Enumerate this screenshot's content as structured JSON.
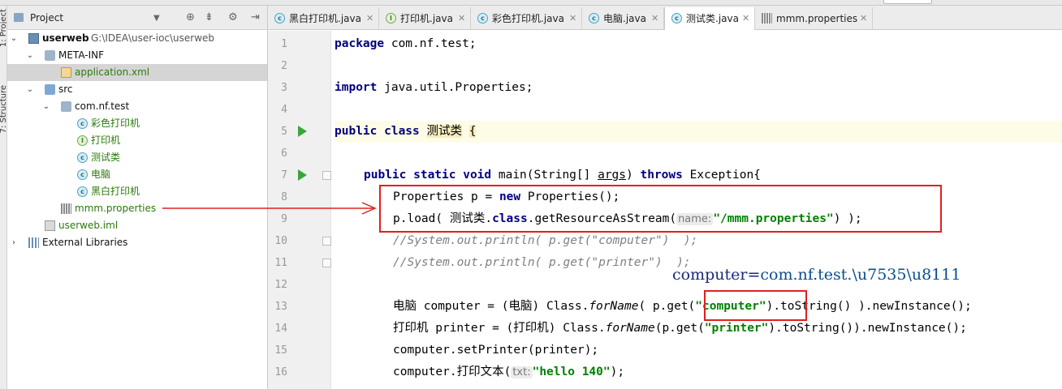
{
  "project_panel": {
    "title": "Project",
    "tool_window_labels": [
      "1: Project",
      "7: Structure"
    ],
    "tree": [
      {
        "label": "userweb",
        "path": "G:\\IDEA\\user-ioc\\userweb",
        "kind": "module",
        "expanded": true
      },
      {
        "label": "META-INF",
        "kind": "folder",
        "expanded": true
      },
      {
        "label": "application.xml",
        "kind": "xml",
        "selected": true
      },
      {
        "label": "src",
        "kind": "src-folder",
        "expanded": true
      },
      {
        "label": "com.nf.test",
        "kind": "package",
        "expanded": true
      },
      {
        "label": "彩色打印机",
        "kind": "class"
      },
      {
        "label": "打印机",
        "kind": "interface"
      },
      {
        "label": "测试类",
        "kind": "class-main"
      },
      {
        "label": "电脑",
        "kind": "class"
      },
      {
        "label": "黑白打印机",
        "kind": "class"
      },
      {
        "label": "mmm.properties",
        "kind": "properties"
      },
      {
        "label": "userweb.iml",
        "kind": "iml"
      },
      {
        "label": "External Libraries",
        "kind": "libraries",
        "expanded": false
      }
    ]
  },
  "tabs": [
    {
      "label": "黑白打印机.java",
      "icon": "class-icon",
      "active": false
    },
    {
      "label": "打印机.java",
      "icon": "interface-icon",
      "active": false
    },
    {
      "label": "彩色打印机.java",
      "icon": "class-icon",
      "active": false
    },
    {
      "label": "电脑.java",
      "icon": "class-icon",
      "active": false
    },
    {
      "label": "测试类.java",
      "icon": "class-icon",
      "active": true
    },
    {
      "label": "mmm.properties",
      "icon": "properties-icon",
      "active": false
    }
  ],
  "editor": {
    "line_numbers": [
      "1",
      "2",
      "3",
      "4",
      "5",
      "6",
      "7",
      "8",
      "9",
      "10",
      "11",
      "12",
      "13",
      "14",
      "15",
      "16"
    ],
    "run_markers_on_lines": [
      5,
      7
    ],
    "lines": {
      "l1": {
        "kw": "package",
        "rest": " com.nf.test;"
      },
      "l3": {
        "kw": "import",
        "rest": " java.util.Properties;"
      },
      "l5": {
        "kw": "public class",
        "name": "测试类",
        "brace": "{"
      },
      "l7": {
        "kw1": "public static void",
        "a": " main(String[] ",
        "args": "args",
        "b": ") ",
        "kw2": "throws",
        "c": " Exception{"
      },
      "l8": {
        "a": "Properties p = ",
        "kw": "new",
        "b": " Properties();"
      },
      "l9": {
        "a": "p.load( 测试类.",
        "kw": "class",
        "b": ".getResourceAsStream(",
        "hint": "name:",
        "str": "\"/mmm.properties\"",
        "c": ") );"
      },
      "l10": {
        "cmt": "//System.out.println( p.get(\"computer\")  );"
      },
      "l11": {
        "cmt": "//System.out.println( p.get(\"printer\")  );"
      },
      "l13": {
        "a": "电脑 computer = (电脑) Class.",
        "m": "forName",
        "b": "( p.get(",
        "str": "\"computer\"",
        "c": ").toString() ).newInstance();"
      },
      "l14": {
        "a": "打印机 printer = (打印机) Class.",
        "m": "forName",
        "b": "(p.get(",
        "str": "\"printer\"",
        "c": ").toString()).newInstance();"
      },
      "l15": {
        "a": "computer.setPrinter(printer);"
      },
      "l16": {
        "a": "computer.打印文本(",
        "hint": "txt:",
        "str": "\"hello 140\"",
        "c": ");"
      }
    }
  },
  "annotation": {
    "key": "computer=",
    "value": "com.nf.test.\\u7535\\u8111",
    "color": "#e02020"
  }
}
